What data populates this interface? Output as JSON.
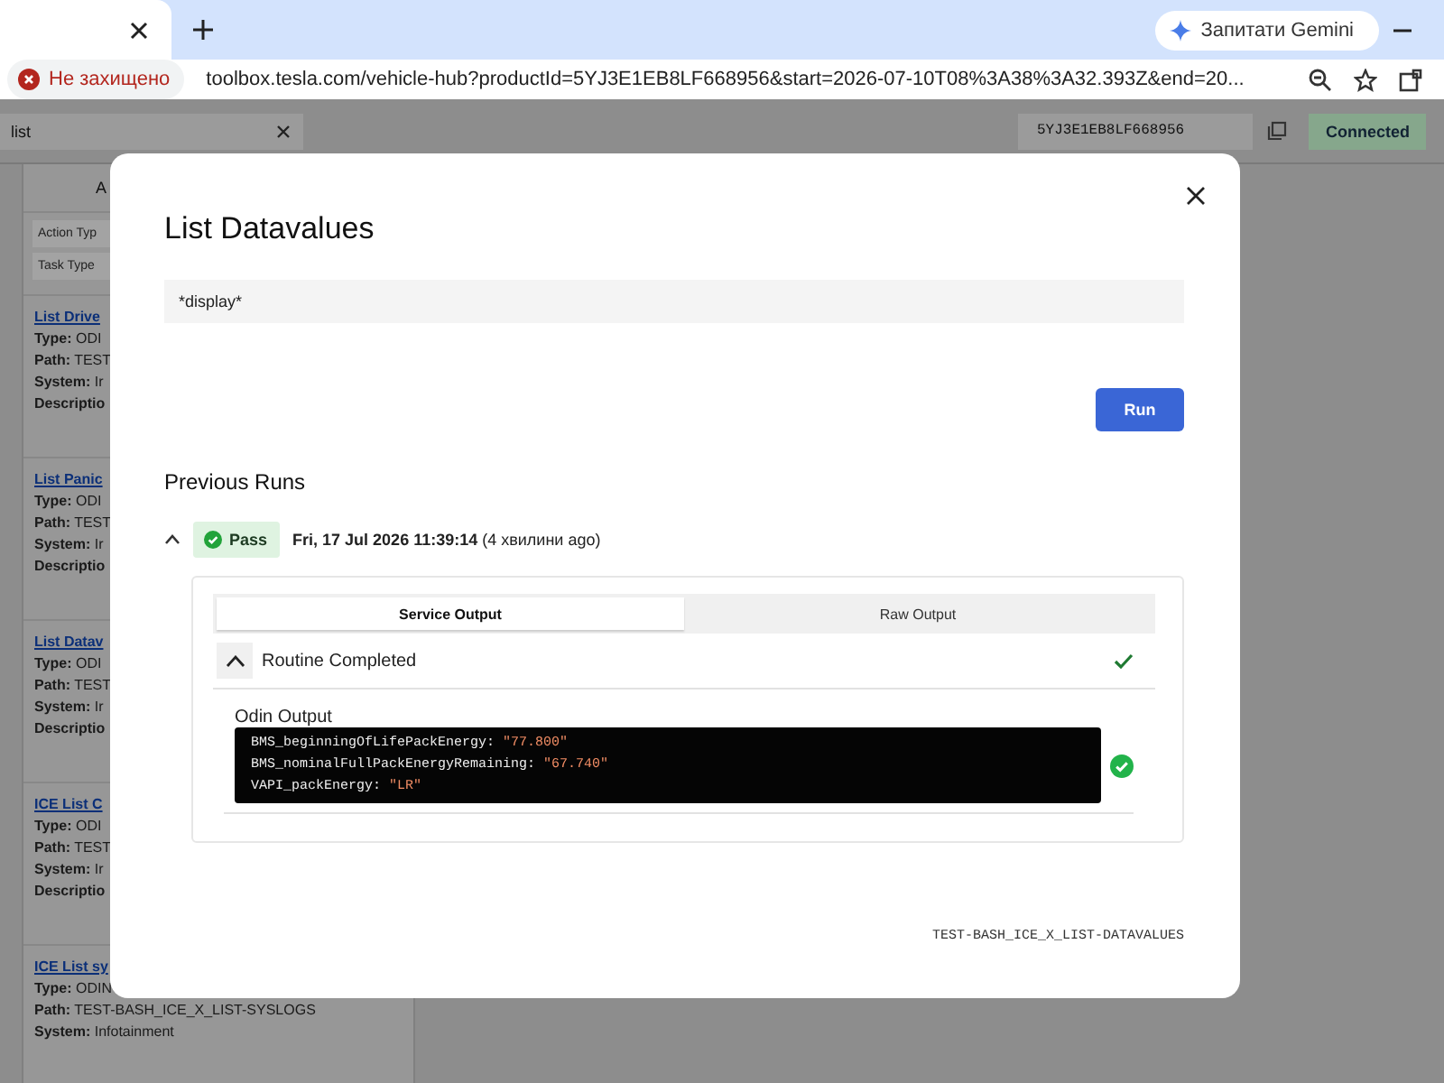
{
  "browser": {
    "gemini_button": "Запитати Gemini",
    "security_label": "Не захищено",
    "url": "toolbox.tesla.com/vehicle-hub?productId=5YJ3E1EB8LF668956&start=2026-07-10T08%3A38%3A32.393Z&end=20..."
  },
  "topbar": {
    "search_value": "list",
    "vehicle_id": "5YJ3E1EB8LF668956",
    "status": "Connected"
  },
  "sidebar": {
    "header": "A",
    "filters": [
      "Action Typ",
      "Task Type"
    ],
    "items": [
      {
        "title": "List Drive",
        "fields": [
          {
            "label": "Type:",
            "value": "ODI"
          },
          {
            "label": "Path:",
            "value": "TEST"
          },
          {
            "label": "System:",
            "value": "Ir"
          },
          {
            "label": "Descriptio"
          }
        ]
      },
      {
        "title": "List Panic",
        "fields": [
          {
            "label": "Type:",
            "value": "ODI"
          },
          {
            "label": "Path:",
            "value": "TEST"
          },
          {
            "label": "System:",
            "value": "Ir"
          },
          {
            "label": "Descriptio"
          }
        ]
      },
      {
        "title": "List Datav",
        "fields": [
          {
            "label": "Type:",
            "value": "ODI"
          },
          {
            "label": "Path:",
            "value": "TEST"
          },
          {
            "label": "System:",
            "value": "Ir"
          },
          {
            "label": "Descriptio"
          }
        ]
      },
      {
        "title": "ICE List C",
        "fields": [
          {
            "label": "Type:",
            "value": "ODI"
          },
          {
            "label": "Path:",
            "value": "TEST"
          },
          {
            "label": "System:",
            "value": "Ir"
          },
          {
            "label": "Descriptio"
          }
        ]
      },
      {
        "title": "ICE List sy",
        "fields": [
          {
            "label": "Type:",
            "value": "ODIN"
          },
          {
            "label": "Path:",
            "value": "TEST-BASH_ICE_X_LIST-SYSLOGS"
          },
          {
            "label": "System:",
            "value": "Infotainment"
          }
        ]
      }
    ]
  },
  "modal": {
    "title": "List Datavalues",
    "query": "*display*",
    "run_button": "Run",
    "previous_runs_title": "Previous Runs",
    "runs": [
      {
        "expanded": true,
        "passed": true,
        "status": "Pass",
        "timestamp": "**Fri, 17 Jul 2026 11:39:14** (4 хвилини ago)",
        "tabs": [
          {
            "label": "Service Output",
            "selected": true
          },
          {
            "label": "Raw Output",
            "selected": false
          }
        ],
        "steps": [
          {
            "title": "Routine Completed",
            "expanded": true,
            "passed": true,
            "output_label": "Odin Output",
            "output_ok": true,
            "lines": [
              {
                "key": "BMS_beginningOfLifePackEnergy:",
                "value": "\"77.800\""
              },
              {
                "key": "BMS_nominalFullPackEnergyRemaining:",
                "value": "\"67.740\""
              },
              {
                "key": "VAPI_packEnergy:",
                "value": "\"LR\""
              }
            ]
          }
        ]
      }
    ],
    "footer_id": "TEST-BASH_ICE_X_LIST-DATAVALUES"
  }
}
